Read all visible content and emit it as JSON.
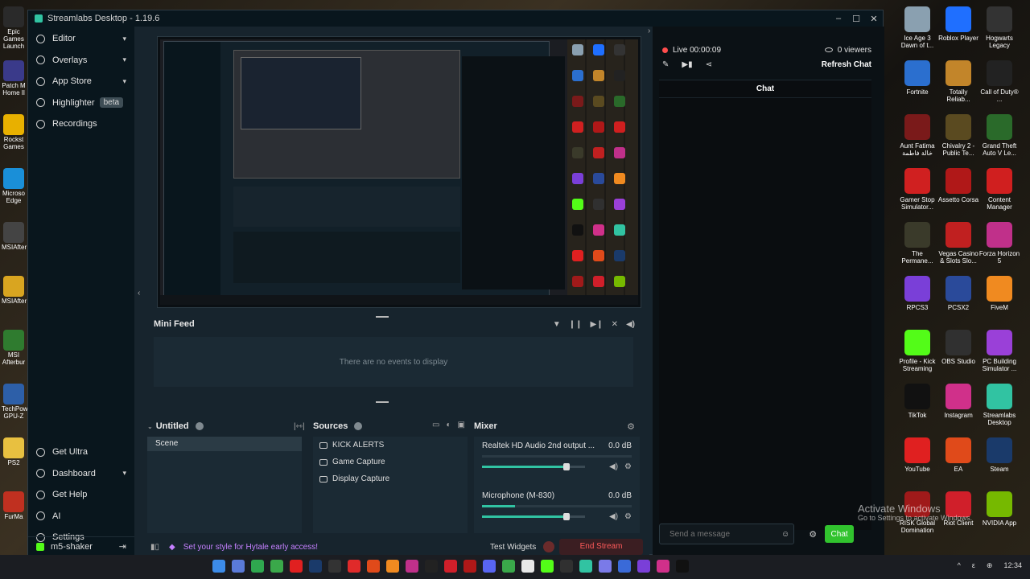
{
  "window": {
    "title": "Streamlabs Desktop - 1.19.6",
    "controls": [
      "–",
      "☐",
      "✕"
    ]
  },
  "sidebar": {
    "items": [
      {
        "label": "Editor",
        "icon": "editor-icon",
        "has_chevron": true
      },
      {
        "label": "Overlays",
        "icon": "overlays-icon",
        "has_chevron": true
      },
      {
        "label": "App Store",
        "icon": "app-store-icon",
        "has_chevron": true
      },
      {
        "label": "Highlighter",
        "icon": "highlighter-icon",
        "badge": "beta"
      },
      {
        "label": "Recordings",
        "icon": "recordings-icon"
      }
    ],
    "bottom_items": [
      {
        "label": "Get Ultra",
        "icon": "ultra-icon"
      },
      {
        "label": "Dashboard",
        "icon": "dashboard-icon",
        "has_chevron": true
      },
      {
        "label": "Get Help",
        "icon": "help-icon"
      },
      {
        "label": "AI",
        "icon": "ai-icon"
      },
      {
        "label": "Settings",
        "icon": "gear-icon"
      }
    ],
    "user": "m5-shaker"
  },
  "minifeed": {
    "title": "Mini Feed",
    "empty_text": "There are no events to display"
  },
  "scenes": {
    "title": "Untitled",
    "items": [
      "Scene"
    ]
  },
  "sources": {
    "title": "Sources",
    "items": [
      "KICK ALERTS",
      "Game Capture",
      "Display Capture"
    ]
  },
  "mixer": {
    "title": "Mixer",
    "channels": [
      {
        "name": "Realtek HD Audio 2nd output ...",
        "db": "0.0 dB",
        "level": 0.0,
        "volume": 0.82
      },
      {
        "name": "Microphone (M-830)",
        "db": "0.0 dB",
        "level": 0.22,
        "volume": 0.82
      }
    ]
  },
  "footer": {
    "promo": "Set your style for Hytale early access!",
    "test_widgets": "Test Widgets",
    "end_stream": "End Stream"
  },
  "chat_panel": {
    "live": "Live 00:00:09",
    "viewers": "0 viewers",
    "refresh": "Refresh Chat",
    "chat_title": "Chat",
    "input_placeholder": "Send a message",
    "send_label": "Chat"
  },
  "watermark": {
    "title": "Activate Windows",
    "subtitle": "Go to Settings to activate Windows."
  },
  "desktop_left": [
    {
      "label": "Epic Games Launch",
      "color": "#2a2a2a"
    },
    {
      "label": "Patch M Home Il",
      "color": "#3a3a8a"
    },
    {
      "label": "Rockst Games",
      "color": "#e8b000"
    },
    {
      "label": "Microso Edge",
      "color": "#1a8fd8"
    },
    {
      "label": "MSIAfter",
      "color": "#444"
    },
    {
      "label": "MSIAfter",
      "color": "#d9a520"
    },
    {
      "label": "MSI Afterbur",
      "color": "#2f7b2f"
    },
    {
      "label": "TechPow GPU-Z",
      "color": "#2d5fa8"
    },
    {
      "label": "PS2",
      "color": "#e8c040"
    },
    {
      "label": "FurMa",
      "color": "#c03020"
    }
  ],
  "desktop_right": [
    {
      "label": "Ice Age 3 Dawn of t...",
      "color": "#8aa0b0"
    },
    {
      "label": "Roblox Player",
      "color": "#1f6fff"
    },
    {
      "label": "Hogwarts Legacy",
      "color": "#333"
    },
    {
      "label": "Fortnite",
      "color": "#2b6fcf"
    },
    {
      "label": "Totally Reliab...",
      "color": "#c2852a"
    },
    {
      "label": "Call of Duty® ...",
      "color": "#222"
    },
    {
      "label": "Aunt Fatima خالة فاطمة",
      "color": "#7a1a1a"
    },
    {
      "label": "Chivalry 2 - Public Te...",
      "color": "#5a4a20"
    },
    {
      "label": "Grand Theft Auto V Le...",
      "color": "#2a6a2a"
    },
    {
      "label": "Gamer Stop Simulator...",
      "color": "#d02020"
    },
    {
      "label": "Assetto Corsa",
      "color": "#b01818"
    },
    {
      "label": "Content Manager",
      "color": "#d01f1f"
    },
    {
      "label": "The Permane...",
      "color": "#3a3a2a"
    },
    {
      "label": "Vegas Casino & Slots Slo...",
      "color": "#c02020"
    },
    {
      "label": "Forza Horizon 5",
      "color": "#c0308a"
    },
    {
      "label": "RPCS3",
      "color": "#7a3fd8"
    },
    {
      "label": "PCSX2",
      "color": "#2a4a9a"
    },
    {
      "label": "FiveM",
      "color": "#f08a20"
    },
    {
      "label": "Profile - Kick Streaming",
      "color": "#53fc18"
    },
    {
      "label": "OBS Studio",
      "color": "#303030"
    },
    {
      "label": "PC Building Simulator ...",
      "color": "#9a40d8"
    },
    {
      "label": "TikTok",
      "color": "#111"
    },
    {
      "label": "Instagram",
      "color": "#d0308a"
    },
    {
      "label": "Streamlabs Desktop",
      "color": "#31c3a2"
    },
    {
      "label": "YouTube",
      "color": "#e02020"
    },
    {
      "label": "EA",
      "color": "#e04a1a"
    },
    {
      "label": "Steam",
      "color": "#1a3a6a"
    },
    {
      "label": "RISK Global Domination",
      "color": "#a01a1a"
    },
    {
      "label": "Riot Client",
      "color": "#d01f2a"
    },
    {
      "label": "NVIDIA App",
      "color": "#76b900"
    }
  ],
  "taskbar": {
    "icons": [
      "windows-icon",
      "explorer-icon",
      "terminal-icon",
      "xbox-icon",
      "youtube-icon",
      "steam-icon",
      "next-icon",
      "app-icon",
      "ea-icon",
      "fivem-icon",
      "forza-icon",
      "epic-icon",
      "riot-icon",
      "assetto-icon",
      "discord-icon",
      "xbox-app-icon",
      "chrome-icon",
      "kick-icon",
      "obs-icon",
      "streamlabs-icon",
      "gamepad-icon",
      "vpn-icon",
      "rpcs3-icon",
      "instagram-icon",
      "tiktok-icon"
    ],
    "colors": [
      "#3c8be8",
      "#5a7ad8",
      "#2fa84f",
      "#3aa84a",
      "#e02020",
      "#1a3a6a",
      "#333",
      "#e02a2a",
      "#e04a1a",
      "#f08a20",
      "#c0308a",
      "#222",
      "#d01f2a",
      "#b01818",
      "#5865f2",
      "#3aa84a",
      "#e8e8e8",
      "#53fc18",
      "#303030",
      "#31c3a2",
      "#7a7ae8",
      "#3a6ad8",
      "#7a3fd8",
      "#d0308a",
      "#111"
    ],
    "tray": [
      "^",
      "ε",
      "⊕",
      "12:34"
    ]
  }
}
